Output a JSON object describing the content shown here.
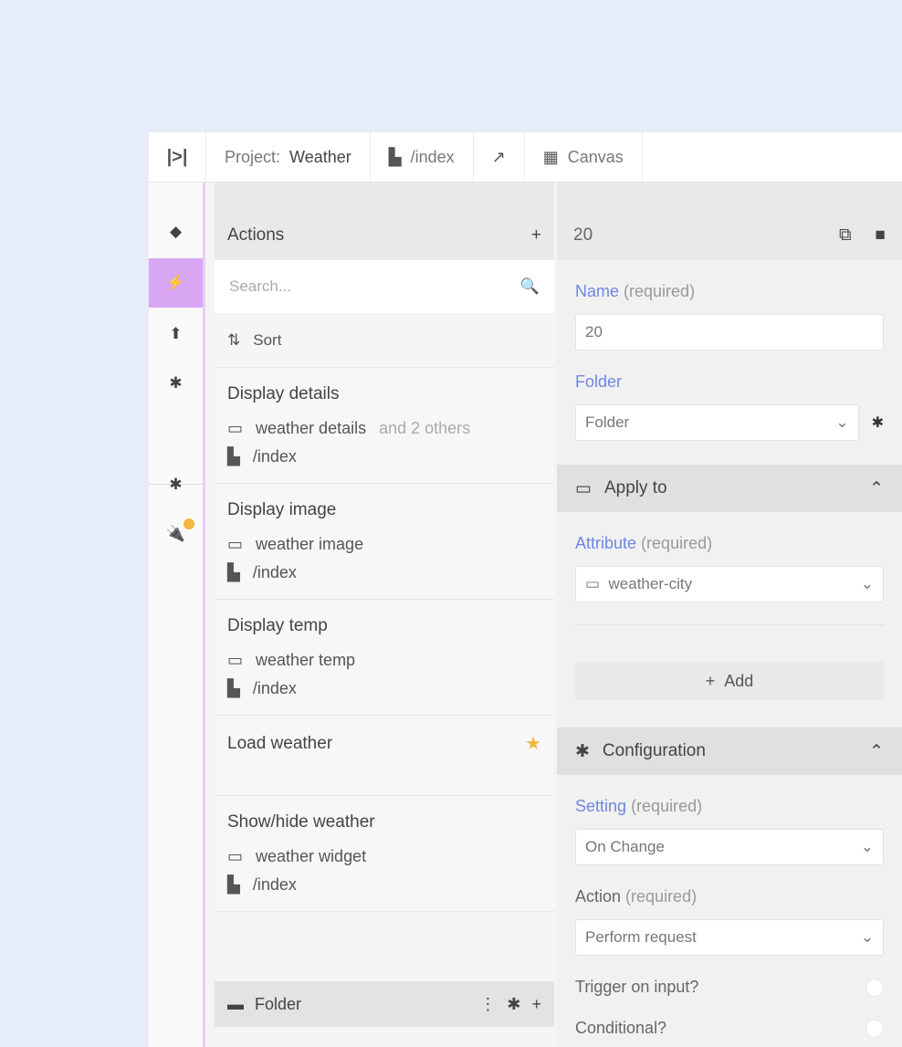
{
  "topbar": {
    "logo": "|>|",
    "project_prefix": "Project:",
    "project_name": "Weather",
    "file_icon": "file-icon",
    "file_label": "/index",
    "external_icon": "external-link-icon",
    "canvas_icon": "calendar-icon",
    "canvas_label": "Canvas"
  },
  "rail": {
    "items": [
      {
        "icon": "component-icon",
        "glyph": "◆"
      },
      {
        "icon": "action-icon",
        "glyph": "⚡"
      },
      {
        "icon": "upload-icon",
        "glyph": "⬆"
      },
      {
        "icon": "gear-icon",
        "glyph": "✱"
      },
      {
        "icon": "bug-icon",
        "glyph": "✱"
      },
      {
        "icon": "plugin-icon",
        "glyph": "🔌"
      }
    ]
  },
  "actions": {
    "title": "Actions",
    "search_placeholder": "Search...",
    "sort_label": "Sort",
    "cards": [
      {
        "title": "Display details",
        "target": "weather details",
        "extra": "and 2 others",
        "file": "/index"
      },
      {
        "title": "Display image",
        "target": "weather image",
        "extra": "",
        "file": "/index"
      },
      {
        "title": "Display temp",
        "target": "weather temp",
        "extra": "",
        "file": "/index"
      },
      {
        "title": "Load weather",
        "target": "",
        "extra": "",
        "file": "",
        "starred": true
      },
      {
        "title": "Show/hide weather",
        "target": "weather widget",
        "extra": "",
        "file": "/index"
      }
    ],
    "folder_row": {
      "label": "Folder"
    }
  },
  "config": {
    "id": "20",
    "name_label": "Name",
    "name_required": "(required)",
    "name_value": "20",
    "folder_label": "Folder",
    "folder_value": "Folder",
    "apply_section": "Apply to",
    "attribute_label": "Attribute",
    "attribute_required": "(required)",
    "attribute_value": "weather-city",
    "add_label": "Add",
    "config_section": "Configuration",
    "setting_label": "Setting",
    "setting_required": "(required)",
    "setting_value": "On Change",
    "action_label": "Action",
    "action_required": "(required)",
    "action_value": "Perform request",
    "trigger_label": "Trigger on input?",
    "conditional_label": "Conditional?"
  }
}
